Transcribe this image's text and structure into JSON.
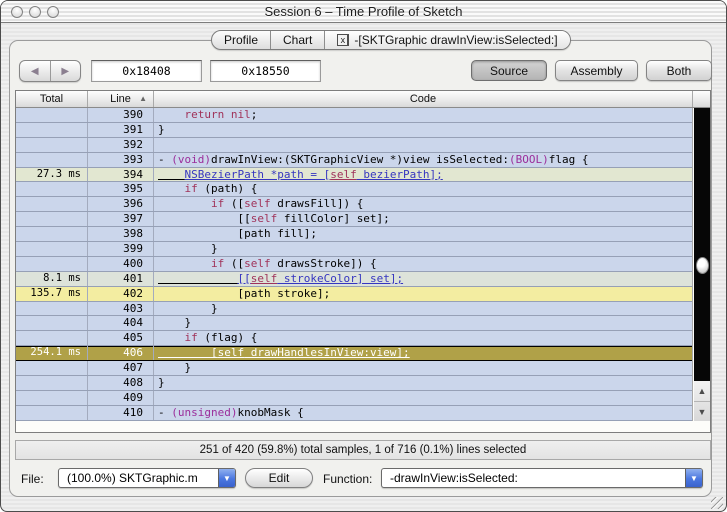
{
  "window": {
    "title": "Session 6 – Time Profile of Sketch"
  },
  "icons": {
    "close_tab": "x",
    "back": "◀",
    "forward": "▶",
    "sort_asc": "▲",
    "combo_arrow": "▼",
    "scroll_up": "▲",
    "scroll_down": "▼"
  },
  "tabs": {
    "items": [
      {
        "label": "Profile"
      },
      {
        "label": "Chart"
      },
      {
        "label": "-[SKTGraphic drawInView:isSelected:]"
      }
    ]
  },
  "toolbar": {
    "address_start": "0x18408",
    "address_end": "0x18550",
    "source_label": "Source",
    "assembly_label": "Assembly",
    "both_label": "Both"
  },
  "code_table": {
    "headers": {
      "total": "Total",
      "line": "Line",
      "code": "Code"
    },
    "rows": [
      {
        "total": "",
        "line": "390",
        "code": [
          [
            "    ",
            "p"
          ],
          [
            "return",
            "kw"
          ],
          [
            " ",
            "p"
          ],
          [
            "nil",
            "kw"
          ],
          [
            ";",
            "p"
          ]
        ]
      },
      {
        "total": "",
        "line": "391",
        "code": [
          [
            "}",
            "p"
          ]
        ]
      },
      {
        "total": "",
        "line": "392",
        "code": []
      },
      {
        "total": "",
        "line": "393",
        "code": [
          [
            "- ",
            "p"
          ],
          [
            "(void)",
            "type"
          ],
          [
            "drawInView:(SKTGraphicView *)view isSelected:",
            "p"
          ],
          [
            "(BOOL)",
            "type"
          ],
          [
            "flag {",
            "p"
          ]
        ]
      },
      {
        "total": "27.3 ms",
        "line": "394",
        "bg": "g1",
        "u": true,
        "code": [
          [
            "    ",
            "p"
          ],
          [
            "NSBezierPath *path = [",
            "link"
          ],
          [
            "self",
            "kw"
          ],
          [
            " bezierPath];",
            "link"
          ]
        ]
      },
      {
        "total": "",
        "line": "395",
        "code": [
          [
            "    ",
            "p"
          ],
          [
            "if",
            "kw"
          ],
          [
            " (path) {",
            "p"
          ]
        ]
      },
      {
        "total": "",
        "line": "396",
        "code": [
          [
            "        ",
            "p"
          ],
          [
            "if",
            "kw"
          ],
          [
            " ([",
            "p"
          ],
          [
            "self",
            "kw"
          ],
          [
            " drawsFill]) {",
            "p"
          ]
        ]
      },
      {
        "total": "",
        "line": "397",
        "code": [
          [
            "            [[",
            "p"
          ],
          [
            "self",
            "kw"
          ],
          [
            " fillColor] set];",
            "p"
          ]
        ]
      },
      {
        "total": "",
        "line": "398",
        "code": [
          [
            "            [path fill];",
            "p"
          ]
        ]
      },
      {
        "total": "",
        "line": "399",
        "code": [
          [
            "        }",
            "p"
          ]
        ]
      },
      {
        "total": "",
        "line": "400",
        "code": [
          [
            "        ",
            "p"
          ],
          [
            "if",
            "kw"
          ],
          [
            " ([",
            "p"
          ],
          [
            "self",
            "kw"
          ],
          [
            " drawsStroke]) {",
            "p"
          ]
        ]
      },
      {
        "total": "8.1 ms",
        "line": "401",
        "bg": "g2",
        "u": true,
        "code": [
          [
            "            ",
            "p"
          ],
          [
            "[[",
            "link"
          ],
          [
            "self",
            "kw"
          ],
          [
            " strokeColor] set];",
            "link"
          ]
        ]
      },
      {
        "total": "135.7 ms",
        "line": "402",
        "bg": "yellow",
        "code": [
          [
            "            [path stroke];",
            "p"
          ]
        ]
      },
      {
        "total": "",
        "line": "403",
        "code": [
          [
            "        }",
            "p"
          ]
        ]
      },
      {
        "total": "",
        "line": "404",
        "code": [
          [
            "    }",
            "p"
          ]
        ]
      },
      {
        "total": "",
        "line": "405",
        "code": [
          [
            "    ",
            "p"
          ],
          [
            "if",
            "kw"
          ],
          [
            " (flag) {",
            "p"
          ]
        ]
      },
      {
        "total": "254.1 ms",
        "line": "406",
        "bg": "sel",
        "u": true,
        "code": [
          [
            "        ",
            "p"
          ],
          [
            "[",
            "link"
          ],
          [
            "self",
            "kw"
          ],
          [
            " drawHandlesInView:view];",
            "link"
          ]
        ]
      },
      {
        "total": "",
        "line": "407",
        "code": [
          [
            "    }",
            "p"
          ]
        ]
      },
      {
        "total": "",
        "line": "408",
        "code": [
          [
            "}",
            "p"
          ]
        ]
      },
      {
        "total": "",
        "line": "409",
        "code": []
      },
      {
        "total": "",
        "line": "410",
        "code": [
          [
            "- ",
            "p"
          ],
          [
            "(unsigned)",
            "type"
          ],
          [
            "knobMask {",
            "p"
          ]
        ]
      }
    ]
  },
  "status_bar": {
    "text": "251 of 420 (59.8%) total samples, 1 of 716 (0.1%) lines selected"
  },
  "footer": {
    "file_label": "File:",
    "file_value": "(100.0%) SKTGraphic.m",
    "edit_label": "Edit",
    "function_label": "Function:",
    "function_value": "-drawInView:isSelected:"
  },
  "colors": {
    "row_default": "#cbd6eb",
    "row_hot_green": "#e2e7d1",
    "row_hot_yellow": "#f3eda1",
    "row_selected": "#b0a148",
    "keyword": "#a0335a",
    "type": "#9b2e9b",
    "link": "#3636c0",
    "combo_accent": "#4a77e0"
  }
}
